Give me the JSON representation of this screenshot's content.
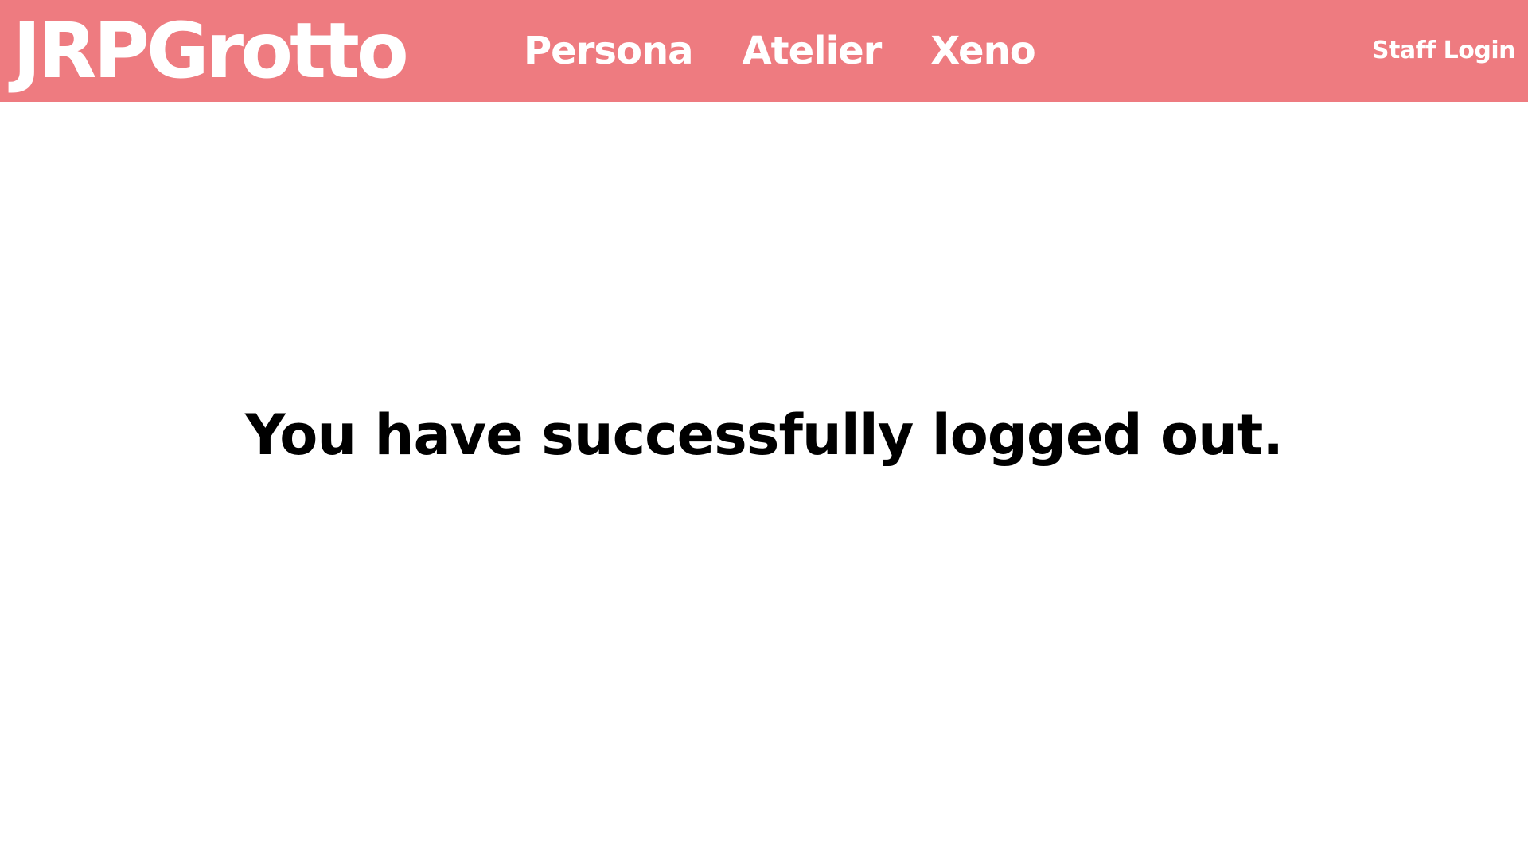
{
  "header": {
    "logo": "JRPGrotto",
    "nav": [
      {
        "label": "Persona"
      },
      {
        "label": "Atelier"
      },
      {
        "label": "Xeno"
      }
    ],
    "staff_login": "Staff Login"
  },
  "main": {
    "message": "You have successfully logged out."
  },
  "colors": {
    "header_bg": "#ee7b80",
    "header_text": "#ffffff",
    "body_bg": "#ffffff",
    "message_text": "#000000"
  }
}
